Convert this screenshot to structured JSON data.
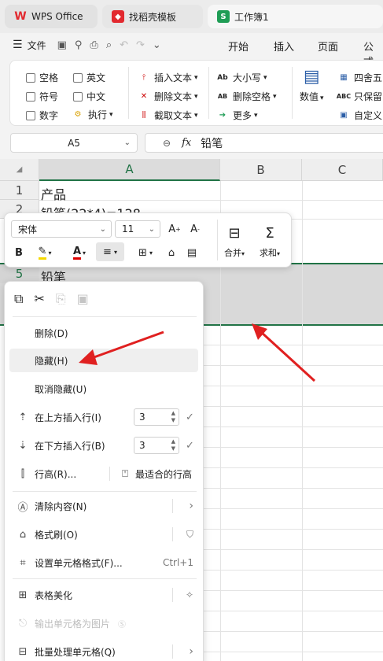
{
  "tabs": [
    {
      "label": "WPS Office",
      "icon": "wps-logo-icon"
    },
    {
      "label": "找稻壳模板",
      "icon": "docer-logo-icon"
    },
    {
      "label": "工作簿1",
      "icon": "spreadsheet-logo-icon"
    }
  ],
  "menubar": {
    "file": "文件",
    "tabs": [
      "开始",
      "插入",
      "页面",
      "公式"
    ]
  },
  "ribbon": {
    "checks": [
      "空格",
      "英文",
      "符号",
      "中文",
      "数字"
    ],
    "execute": "执行",
    "insert_text": "插入文本",
    "delete_text": "删除文本",
    "extract_text": "截取文本",
    "case": "大小写",
    "delete_space": "删除空格",
    "more": "更多",
    "value": "数值",
    "round": "四舍五",
    "keep_only": "只保留",
    "custom": "自定义"
  },
  "formula_bar": {
    "name_box": "A5",
    "fx": "fx",
    "value": "铅笔"
  },
  "grid": {
    "columns": [
      "A",
      "B",
      "C"
    ],
    "rows": [
      "1",
      "2",
      "5"
    ],
    "cells": [
      "产品",
      "铅笔(22*4)=128",
      "铅笔"
    ]
  },
  "mini_toolbar": {
    "font": "宋体",
    "size": "11",
    "merge": "合并",
    "sum": "求和"
  },
  "context_menu": {
    "delete": "删除(D)",
    "hide": "隐藏(H)",
    "unhide": "取消隐藏(U)",
    "insert_above": "在上方插入行(I)",
    "insert_above_value": "3",
    "insert_below": "在下方插入行(B)",
    "insert_below_value": "3",
    "row_height": "行高(R)...",
    "best_fit": "最适合的行高",
    "clear": "清除内容(N)",
    "format_painter": "格式刷(O)",
    "format_cells": "设置单元格格式(F)...",
    "format_cells_shortcut": "Ctrl+1",
    "beautify": "表格美化",
    "export_image": "输出单元格为图片",
    "batch": "批量处理单元格(Q)"
  },
  "colors": {
    "accent_green": "#217346",
    "arrow_red": "#e02020",
    "wps_red": "#e2292f"
  }
}
